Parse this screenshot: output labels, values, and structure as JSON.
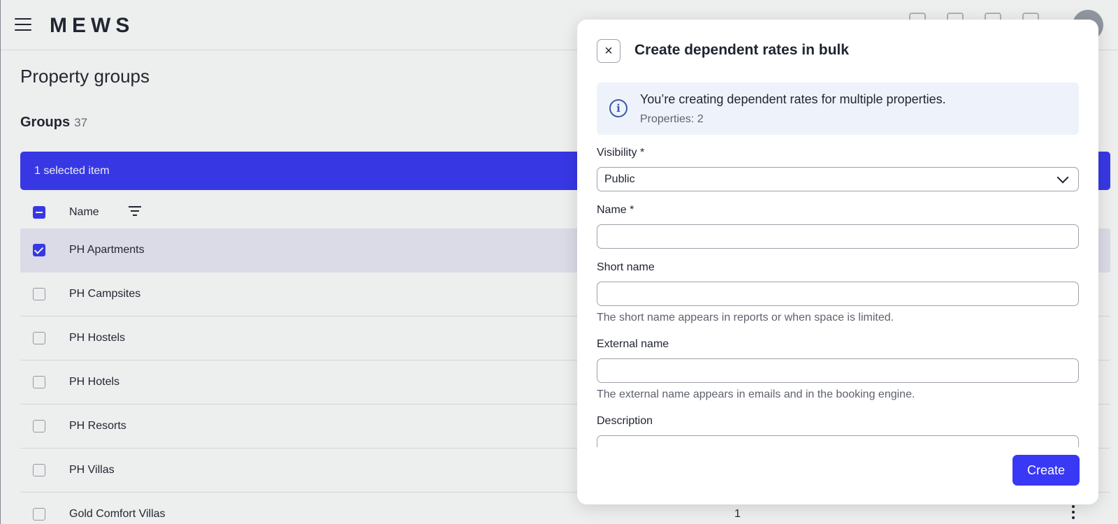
{
  "app": {
    "logo": "MEWS",
    "page_title": "Property groups",
    "groups_label": "Groups",
    "groups_count": "37",
    "selection_text": "1 selected item",
    "table": {
      "column_name": "Name",
      "rows": [
        {
          "name": "PH Apartments",
          "selected": true,
          "count": ""
        },
        {
          "name": "PH Campsites",
          "selected": false,
          "count": ""
        },
        {
          "name": "PH Hostels",
          "selected": false,
          "count": ""
        },
        {
          "name": "PH Hotels",
          "selected": false,
          "count": ""
        },
        {
          "name": "PH Resorts",
          "selected": false,
          "count": ""
        },
        {
          "name": "PH Villas",
          "selected": false,
          "count": ""
        },
        {
          "name": "Gold Comfort Villas",
          "selected": false,
          "count": "1"
        }
      ]
    }
  },
  "drawer": {
    "title": "Create dependent rates in bulk",
    "close_icon": "×",
    "info": {
      "icon": "i",
      "message": "You’re creating dependent rates for multiple properties.",
      "properties": "Properties: 2"
    },
    "visibility": {
      "label": "Visibility *",
      "value": "Public"
    },
    "name": {
      "label": "Name *",
      "value": ""
    },
    "short_name": {
      "label": "Short name",
      "value": "",
      "help": "The short name appears in reports or when space is limited."
    },
    "external_name": {
      "label": "External name",
      "value": "",
      "help": "The external name appears in emails and in the booking engine."
    },
    "description": {
      "label": "Description",
      "value": ""
    },
    "create_label": "Create"
  },
  "colors": {
    "accent": "#3838f5",
    "info_bg": "#eef3fb",
    "selected_row": "#ebebf7"
  }
}
